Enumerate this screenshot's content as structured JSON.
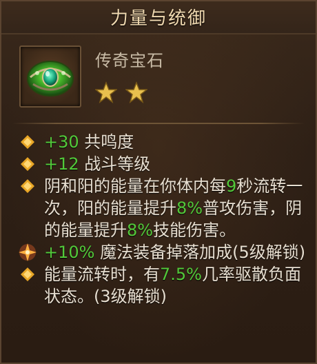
{
  "window": {
    "title": "力量与统御"
  },
  "item": {
    "name": "传奇宝石",
    "stars": 2,
    "icon": "green-gem-icon"
  },
  "stats": [
    {
      "prefix": "",
      "value": "+30",
      "text": " 共鸣度"
    },
    {
      "prefix": "",
      "value": "+12",
      "text": " 战斗等级"
    },
    {
      "parts": [
        "阴和阳的能量在你体内每",
        "9",
        "秒流转一次，阳的能量提升",
        "8%",
        "普攻伤害，阴的能量提升",
        "8%",
        "技能伤害。"
      ]
    },
    {
      "parts": [
        "+10%",
        " 魔法装备掉落加成(5级解锁)"
      ]
    },
    {
      "parts": [
        "能量流转时，有",
        "7.5%",
        "几率驱散负面状态。(3级解锁)"
      ]
    }
  ],
  "colors": {
    "highlight": "#52c93a",
    "title": "#f0d9b0",
    "text": "#e8dfd1",
    "bullet": "#e8a626"
  }
}
